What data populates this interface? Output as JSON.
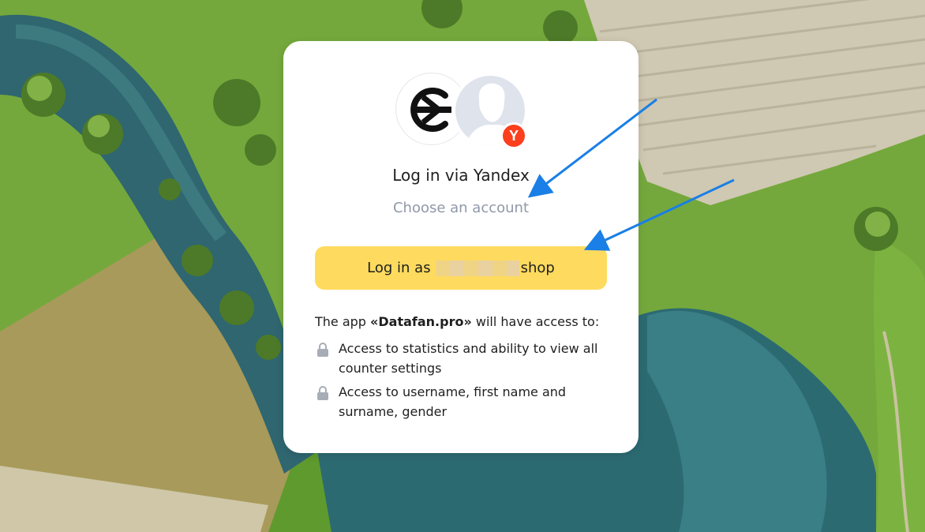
{
  "auth": {
    "title": "Log in via Yandex",
    "subtitle": "Choose an account",
    "login_button_prefix": "Log in as",
    "login_button_suffix": "shop",
    "badge_letter": "Y",
    "access_intro_prefix": "The app ",
    "app_name": "«Datafan.pro»",
    "access_intro_suffix": " will have access to:",
    "permissions": [
      {
        "text": "Access to statistics and ability to view all counter settings",
        "icon": "lock-icon"
      },
      {
        "text": "Access to username, first name and surname, gender",
        "icon": "lock-icon"
      }
    ]
  },
  "colors": {
    "button": "#fedb5e",
    "yandex_red": "#fc3f1d",
    "subtitle": "#9098a8",
    "annotation_arrow": "#1a7fe6"
  }
}
